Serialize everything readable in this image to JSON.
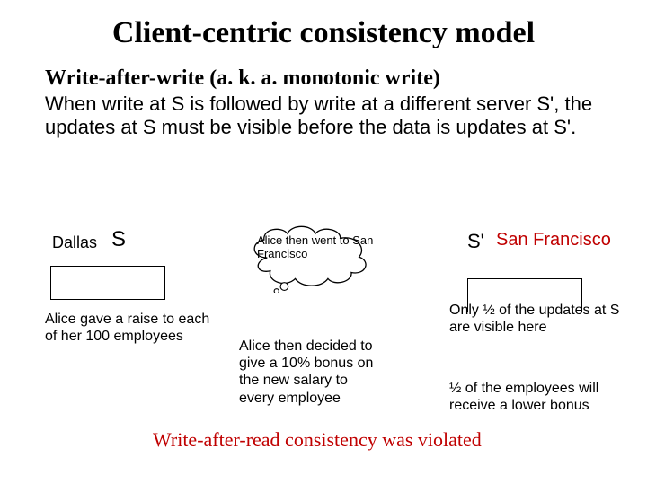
{
  "title": "Client-centric consistency model",
  "subtitle": "Write-after-write (a. k. a. monotonic write)",
  "desc": "When write at S is followed by write at a different server S', the updates at S must be visible before the data is updates at S'.",
  "dallas": "Dallas",
  "s": "S",
  "raise": "Alice gave a raise to each of her 100 employees",
  "cloud": "Alice  then went to San Francisco",
  "bonus": "Alice then decided to give a 10% bonus on the new salary to every employee",
  "sp": "S'",
  "sanfran": "San Francisco",
  "only": "Only ½ of the updates at S are visible here",
  "lowerbonus": "½ of the employees will receive a lower bonus",
  "violated": "Write-after-read consistency was violated"
}
